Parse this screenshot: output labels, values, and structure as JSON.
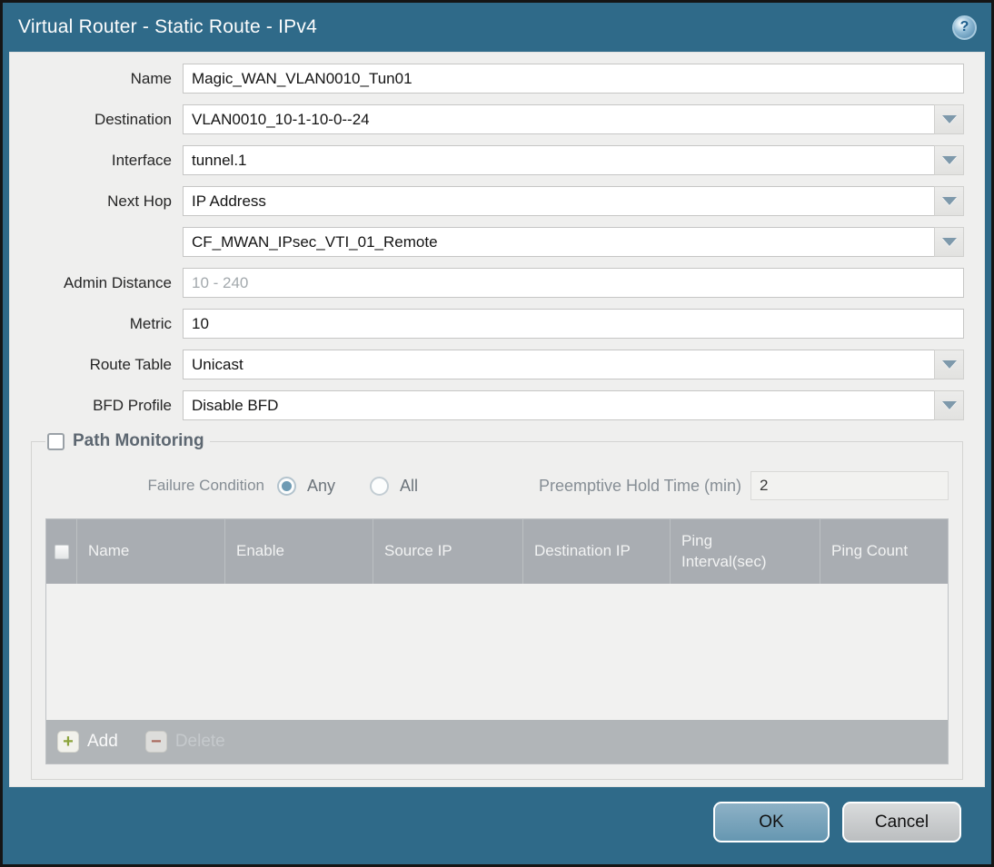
{
  "titlebar": {
    "title": "Virtual Router - Static Route - IPv4",
    "help_glyph": "?"
  },
  "form": {
    "name": {
      "label": "Name",
      "value": "Magic_WAN_VLAN0010_Tun01"
    },
    "destination": {
      "label": "Destination",
      "value": "VLAN0010_10-1-10-0--24"
    },
    "interface": {
      "label": "Interface",
      "value": "tunnel.1"
    },
    "next_hop": {
      "label": "Next Hop",
      "value": "IP Address"
    },
    "next_hop_address": {
      "value": "CF_MWAN_IPsec_VTI_01_Remote"
    },
    "admin_distance": {
      "label": "Admin Distance",
      "placeholder": "10 - 240"
    },
    "metric": {
      "label": "Metric",
      "value": "10"
    },
    "route_table": {
      "label": "Route Table",
      "value": "Unicast"
    },
    "bfd_profile": {
      "label": "BFD Profile",
      "value": "Disable BFD"
    }
  },
  "path_monitoring": {
    "legend": "Path Monitoring",
    "checkbox_checked": false,
    "failure_condition": {
      "label": "Failure Condition",
      "options": [
        {
          "label": "Any",
          "selected": true
        },
        {
          "label": "All",
          "selected": false
        }
      ]
    },
    "preemptive_hold_time": {
      "label": "Preemptive Hold Time (min)",
      "value": "2"
    },
    "table": {
      "columns": [
        "Name",
        "Enable",
        "Source IP",
        "Destination IP",
        "Ping Interval(sec)",
        "Ping Count"
      ],
      "rows": [],
      "add_label": "Add",
      "delete_label": "Delete"
    }
  },
  "footer": {
    "ok_label": "OK",
    "cancel_label": "Cancel"
  },
  "colors": {
    "frame_teal": "#2f6a89",
    "content_bg": "#efefee",
    "table_header_bg": "#a9adb2",
    "table_footer_bg": "#b1b5b8",
    "ok_button": "#6697b1",
    "cancel_button": "#bbbec0",
    "add_icon_green": "#8ca43c",
    "delete_icon_red": "#a96a5e",
    "radio_selected": "#6e9bb4",
    "dropdown_arrow": "#7e99ab"
  }
}
